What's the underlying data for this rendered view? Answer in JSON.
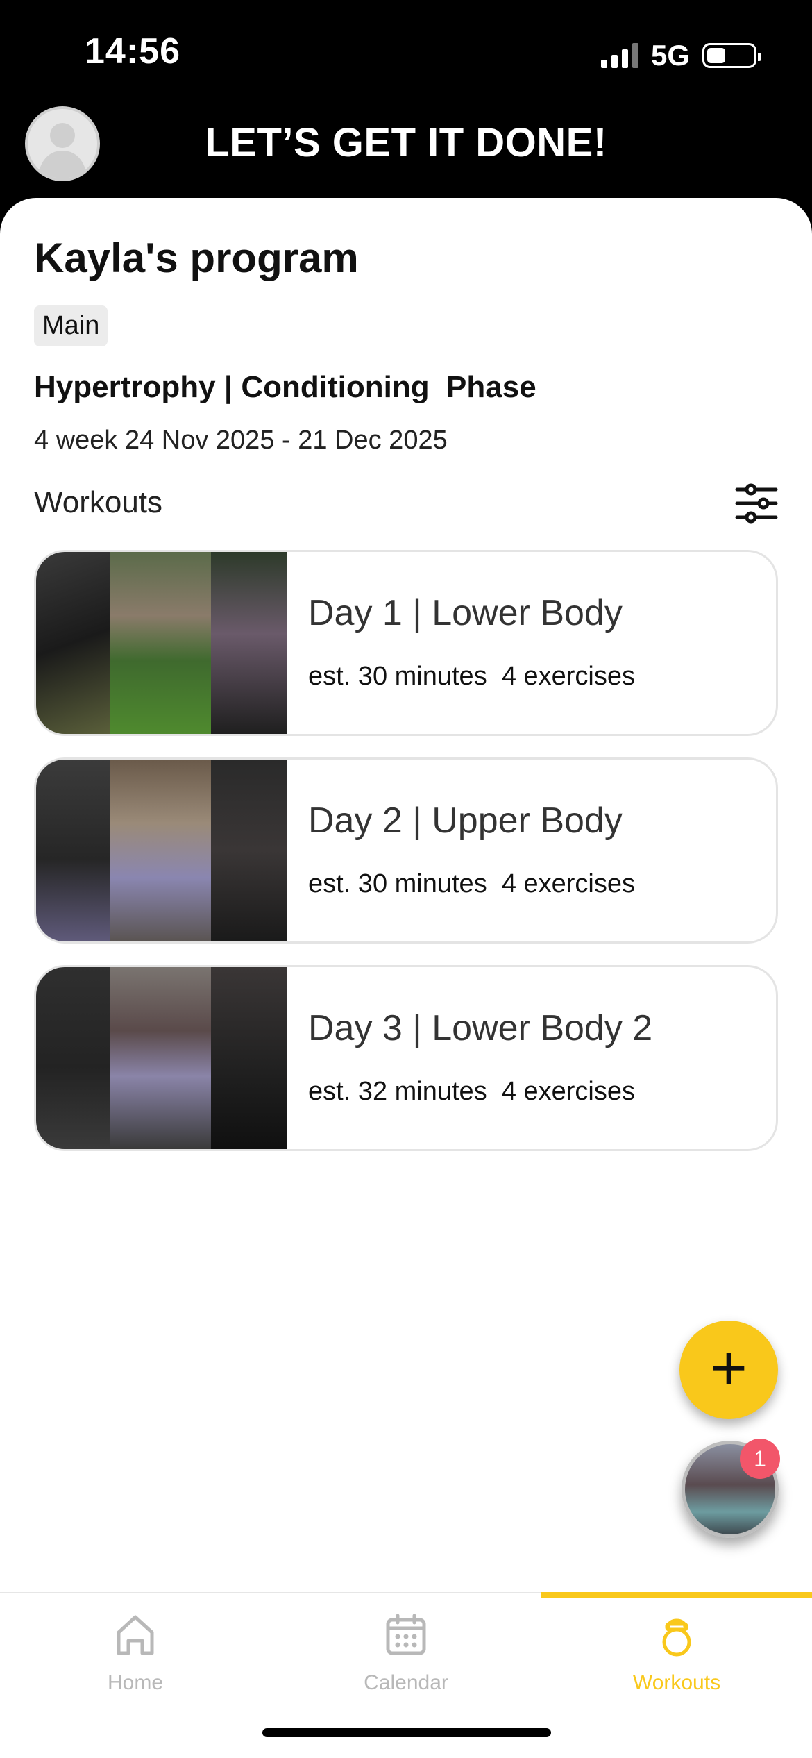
{
  "status_bar": {
    "time": "14:56",
    "network": "5G",
    "icons": [
      "signal-icon",
      "battery-icon"
    ]
  },
  "header": {
    "title": "LET’S GET IT DONE!",
    "avatar_icon": "user-avatar-icon"
  },
  "program": {
    "title": "Kayla's program",
    "tag": "Main",
    "phase": "Hypertrophy | Conditioning  Phase",
    "dates": "4 week 24 Nov 2025 - 21 Dec 2025",
    "workouts_label": "Workouts",
    "filter_icon": "sliders-icon"
  },
  "workouts": [
    {
      "title": "Day 1 | Lower Body",
      "duration": "est. 30 minutes",
      "exercises": "4 exercises"
    },
    {
      "title": "Day 2 | Upper Body",
      "duration": "est. 30 minutes",
      "exercises": "4 exercises"
    },
    {
      "title": "Day 3 | Lower Body 2",
      "duration": "est. 32 minutes",
      "exercises": "4 exercises"
    }
  ],
  "fab": {
    "icon": "plus-icon",
    "label": "+"
  },
  "coach": {
    "badge_count": "1"
  },
  "tabs": [
    {
      "label": "Home",
      "icon": "home-icon",
      "active": false
    },
    {
      "label": "Calendar",
      "icon": "calendar-icon",
      "active": false
    },
    {
      "label": "Workouts",
      "icon": "kettlebell-icon",
      "active": true
    }
  ],
  "colors": {
    "accent": "#F9C81B",
    "badge": "#F2566A",
    "inactive_tab": "#B8B8B8",
    "header_bg": "#000000"
  }
}
